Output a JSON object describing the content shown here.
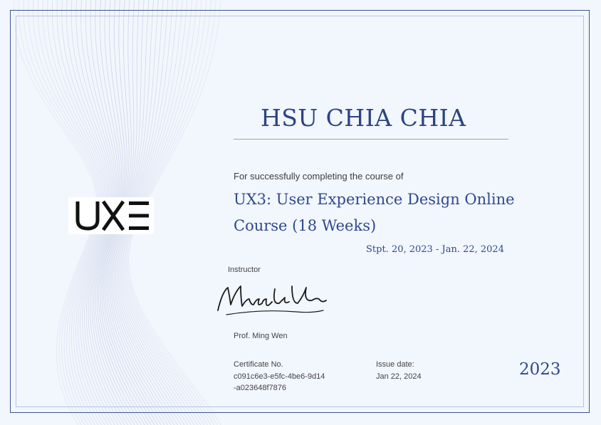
{
  "recipient": {
    "name": "HSU CHIA CHIA"
  },
  "completion_text": "For successfully completing the course of",
  "course": {
    "title": "UX3: User Experience Design Online Course (18 Weeks)"
  },
  "dates": "Stpt. 20, 2023 - Jan. 22, 2024",
  "instructor": {
    "label": "Instructor",
    "signature": "Minghu Wen",
    "name": "Prof. Ming Wen"
  },
  "certificate": {
    "label": "Certificate No.",
    "number": "c091c6e3-e5fc-4be6-9d14-a023648f7876"
  },
  "issue": {
    "label": "Issue date:",
    "date": "Jan 22, 2024"
  },
  "year": "2023",
  "logo": {
    "text": "UXE",
    "icon": "uxe-logo"
  },
  "colors": {
    "accent": "#2e4a8c",
    "background": "#f2f6fd",
    "border": "#3d5493"
  }
}
